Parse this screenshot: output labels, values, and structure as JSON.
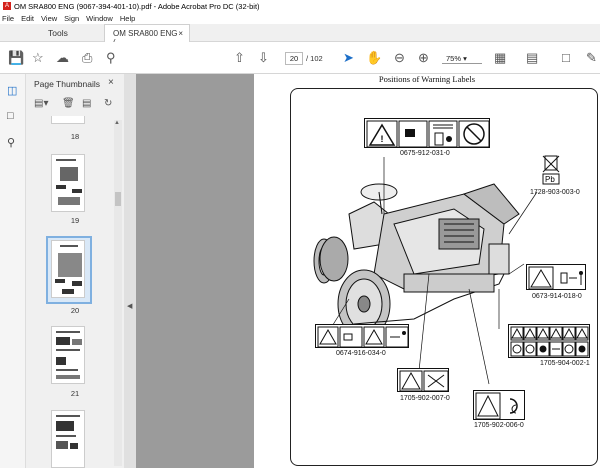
{
  "window": {
    "title": "OM SRA800 ENG (9067-394-401-10).pdf - Adobe Acrobat Pro DC (32-bit)"
  },
  "menu": [
    "File",
    "Edit",
    "View",
    "Sign",
    "Window",
    "Help"
  ],
  "tabs": {
    "tools": "Tools",
    "document": "OM SRA800 ENG (...",
    "close": "×"
  },
  "toolbar": {
    "current_page": "20",
    "total_pages": "/ 102",
    "zoom": "75%"
  },
  "thumbnails": {
    "title": "Page Thumbnails",
    "close": "×",
    "pages": [
      "18",
      "19",
      "20",
      "21"
    ],
    "selected": "20"
  },
  "document": {
    "heading": "Positions of Warning Labels",
    "labels": {
      "l1": "0675-912-031-0",
      "l2": "1728-903-003-0",
      "l3": "0673-914-018-0",
      "l4": "0674-916-034-0",
      "l5": "1705-904-002-1",
      "l6": "1705-902-007-0",
      "l7": "1705-902-006-0"
    },
    "sticker_text": {
      "pb": "Pb"
    }
  },
  "colors": {
    "selected_thumb": "#7fb0e0",
    "app_red": "#d4221c",
    "doc_bg": "#9b9b9b"
  }
}
